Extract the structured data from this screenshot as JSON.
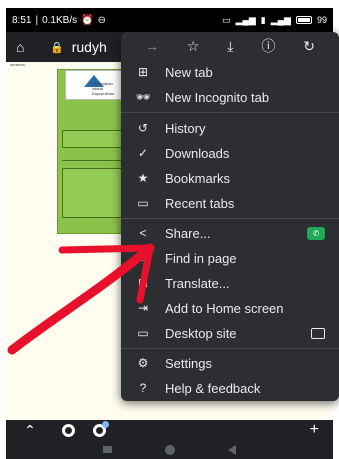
{
  "status_bar": {
    "time": "8:51",
    "network_speed": "0.1KB/s",
    "battery": "99"
  },
  "url_bar": {
    "url": "rudyh"
  },
  "page": {
    "tiny_text": "beranda",
    "logo_text": "Perumahan Istana Kayuputihan"
  },
  "menu": {
    "items": [
      {
        "label": "New tab",
        "icon": "new-tab-icon"
      },
      {
        "label": "New Incognito tab",
        "icon": "incognito-icon"
      },
      {
        "label": "History",
        "icon": "history-icon"
      },
      {
        "label": "Downloads",
        "icon": "downloads-icon"
      },
      {
        "label": "Bookmarks",
        "icon": "bookmark-icon"
      },
      {
        "label": "Recent tabs",
        "icon": "recent-tabs-icon"
      },
      {
        "label": "Share...",
        "icon": "share-icon"
      },
      {
        "label": "Find in page",
        "icon": "find-icon"
      },
      {
        "label": "Translate...",
        "icon": "translate-icon"
      },
      {
        "label": "Add to Home screen",
        "icon": "add-home-icon"
      },
      {
        "label": "Desktop site",
        "icon": "desktop-icon"
      },
      {
        "label": "Settings",
        "icon": "gear-icon"
      },
      {
        "label": "Help & feedback",
        "icon": "help-icon"
      }
    ]
  },
  "colors": {
    "menu_bg": "#2d2e31",
    "arrow": "#e8102a",
    "whatsapp": "#1fa855"
  }
}
